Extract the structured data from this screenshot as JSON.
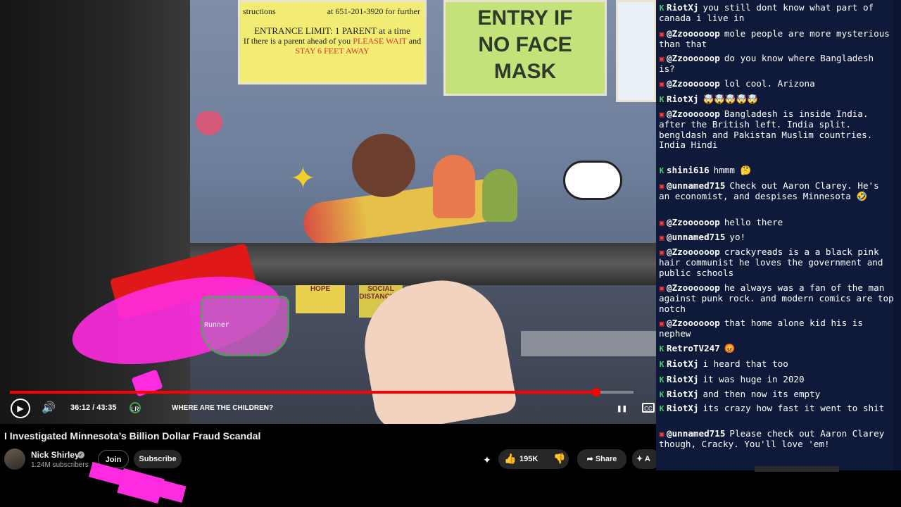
{
  "video": {
    "poster_a": {
      "line1": "at 651-201-3920 for further",
      "line2": "structions",
      "line3": "ENTRANCE LIMIT: 1 PARENT at a time",
      "line4a": "If there is a parent ahead of you ",
      "line4b": "PLEASE WAIT",
      "line4c": " and",
      "line5": "STAY 6 FEET AWAY"
    },
    "poster_b": {
      "line1": "ENTRY IF",
      "line2": "NO FACE",
      "line3": "MASK"
    },
    "sticker_1": "HOPE",
    "sticker_2": "SOCIAL DISTANCING",
    "overlay_text": "Runner",
    "progress_fraction": 0.94,
    "time_current": "36:12",
    "time_total": "43:35",
    "time_display": "36:12 / 43:35",
    "chapter_badge": "LR",
    "chapter_title": "WHERE ARE THE CHILDREN?",
    "icons": {
      "play": "play-icon",
      "volume": "volume-icon",
      "chevron": "chevron-right-icon",
      "pause": "pause-icon",
      "cc": "closed-captions-icon"
    }
  },
  "details": {
    "title": "I Investigated Minnesota’s Billion Dollar Fraud Scandal",
    "channel_name": "Nick Shirley",
    "subscribers": "1.24M subscribers",
    "join_label": "Join",
    "subscribe_label": "Subscribe",
    "like_count": "195K",
    "share_label": "Share",
    "more_label": "A"
  },
  "chat": {
    "messages": [
      {
        "platform": "twitch",
        "user": "RiotXj",
        "text": "you still dont know what part of canada i live in"
      },
      {
        "platform": "youtube",
        "user": "@Zzoooooop",
        "text": "mole people are more mysterious than that"
      },
      {
        "platform": "youtube",
        "user": "@Zzoooooop",
        "text": "do you know where Bangladesh is?"
      },
      {
        "platform": "youtube",
        "user": "@Zzoooooop",
        "text": "lol cool. Arizona"
      },
      {
        "platform": "twitch",
        "user": "RiotXj",
        "text": "🤯🤯🤯🤯🤯"
      },
      {
        "platform": "youtube",
        "user": "@Zzoooooop",
        "text": "Bangladesh is inside India. after the British left. India split. bengldash and Pakistan Muslim countries. India Hindi"
      },
      {
        "platform": "twitch",
        "user": "shini616",
        "text": "hmmm 🤔"
      },
      {
        "platform": "youtube",
        "user": "@unnamed715",
        "text": "Check out Aaron Clarey. He's an economist, and despises Minnesota 🤣"
      },
      {
        "platform": "youtube",
        "user": "@Zzoooooop",
        "text": "hello there"
      },
      {
        "platform": "youtube",
        "user": "@unnamed715",
        "text": "yo!"
      },
      {
        "platform": "youtube",
        "user": "@Zzoooooop",
        "text": "crackyreads is a a black pink hair communist he loves the government and public schools"
      },
      {
        "platform": "youtube",
        "user": "@Zzoooooop",
        "text": "he always was a fan of the man against punk rock. and modern comics are top notch"
      },
      {
        "platform": "youtube",
        "user": "@Zzoooooop",
        "text": "that home alone kid his is nephew"
      },
      {
        "platform": "twitch",
        "user": "RetroTV247",
        "text": "😡"
      },
      {
        "platform": "twitch",
        "user": "RiotXj",
        "text": "i heard that too"
      },
      {
        "platform": "twitch",
        "user": "RiotXj",
        "text": "it was huge in 2020"
      },
      {
        "platform": "twitch",
        "user": "RiotXj",
        "text": "and then now its empty"
      },
      {
        "platform": "twitch",
        "user": "RiotXj",
        "text": "its crazy how fast it went to shit"
      },
      {
        "platform": "youtube",
        "user": "@unnamed715",
        "text": "Please check out Aaron Clarey though, Cracky. You'll love 'em!"
      }
    ]
  },
  "colors": {
    "chat_bg": "#0f1a3a",
    "youtube_badge": "#ff3b3b",
    "twitch_badge": "#3ed36b",
    "progress": "#ff0000"
  }
}
